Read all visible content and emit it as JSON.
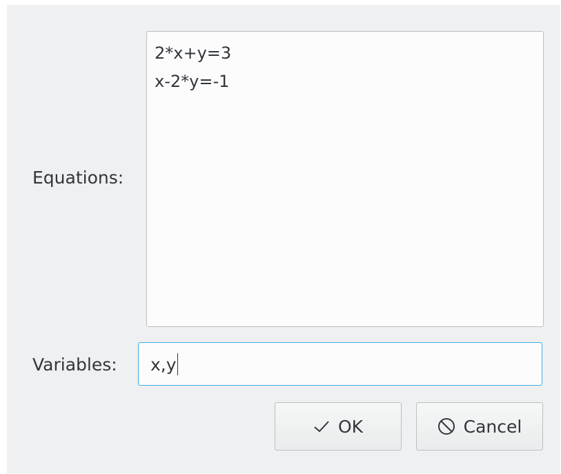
{
  "form": {
    "equations_label": "Equations:",
    "equations_lines": [
      "2*x+y=3",
      "x-2*y=-1"
    ],
    "variables_label": "Variables:",
    "variables_value": "x,y"
  },
  "buttons": {
    "ok_label": "OK",
    "ok_icon": "checkmark-icon",
    "cancel_label": "Cancel",
    "cancel_icon": "cancel-icon"
  },
  "colors": {
    "focus_border": "#3daee9",
    "text": "#31363b",
    "dialog_background": "#eff0f1"
  }
}
